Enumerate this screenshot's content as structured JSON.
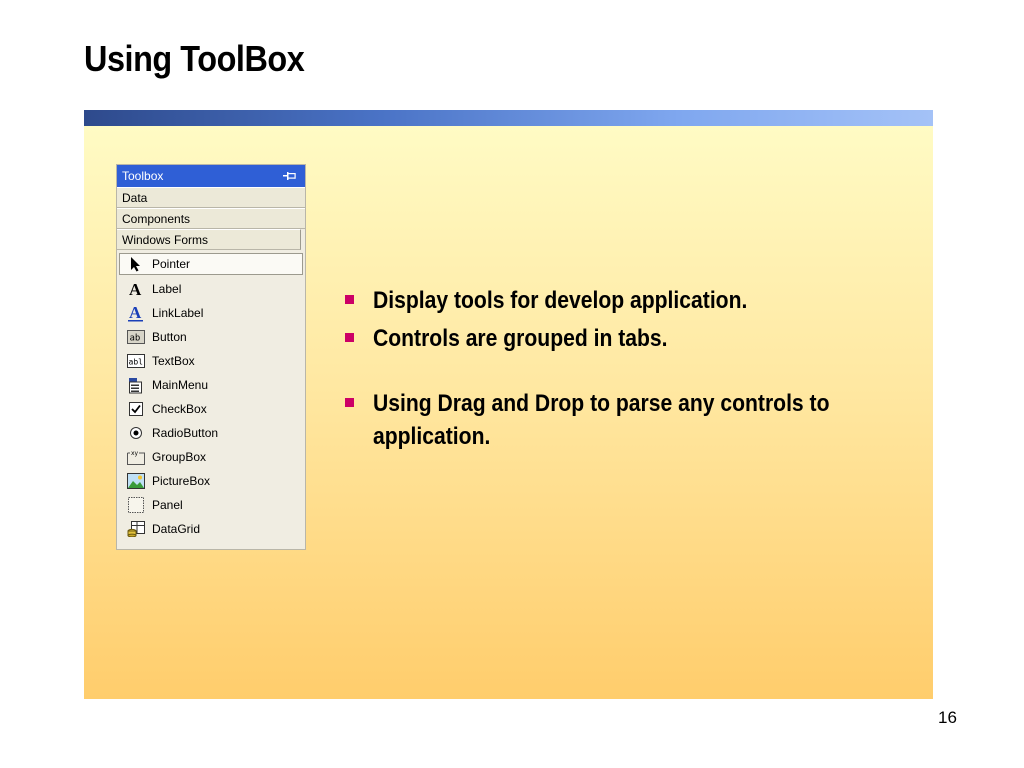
{
  "slide": {
    "title": "Using ToolBox",
    "page_number": "16",
    "bullets": [
      "Display tools for develop application.",
      "Controls are grouped in tabs.",
      "Using Drag and Drop to parse any controls to application."
    ]
  },
  "toolbox": {
    "title": "Toolbox",
    "pin_icon": "pin-icon",
    "tabs": [
      "Data",
      "Components",
      "Windows Forms"
    ],
    "items": [
      {
        "label": "Pointer",
        "icon": "pointer-icon"
      },
      {
        "label": "Label",
        "icon": "label-icon"
      },
      {
        "label": "LinkLabel",
        "icon": "linklabel-icon"
      },
      {
        "label": "Button",
        "icon": "button-icon"
      },
      {
        "label": "TextBox",
        "icon": "textbox-icon"
      },
      {
        "label": "MainMenu",
        "icon": "mainmenu-icon"
      },
      {
        "label": "CheckBox",
        "icon": "checkbox-icon"
      },
      {
        "label": "RadioButton",
        "icon": "radiobutton-icon"
      },
      {
        "label": "GroupBox",
        "icon": "groupbox-icon"
      },
      {
        "label": "PictureBox",
        "icon": "picturebox-icon"
      },
      {
        "label": "Panel",
        "icon": "panel-icon"
      },
      {
        "label": "DataGrid",
        "icon": "datagrid-icon"
      }
    ]
  },
  "colors": {
    "bullet": "#cc0066",
    "toolbox_header": "#2f5fd6",
    "panel_top": "#fffbc4",
    "panel_bottom": "#ffcd6c"
  }
}
